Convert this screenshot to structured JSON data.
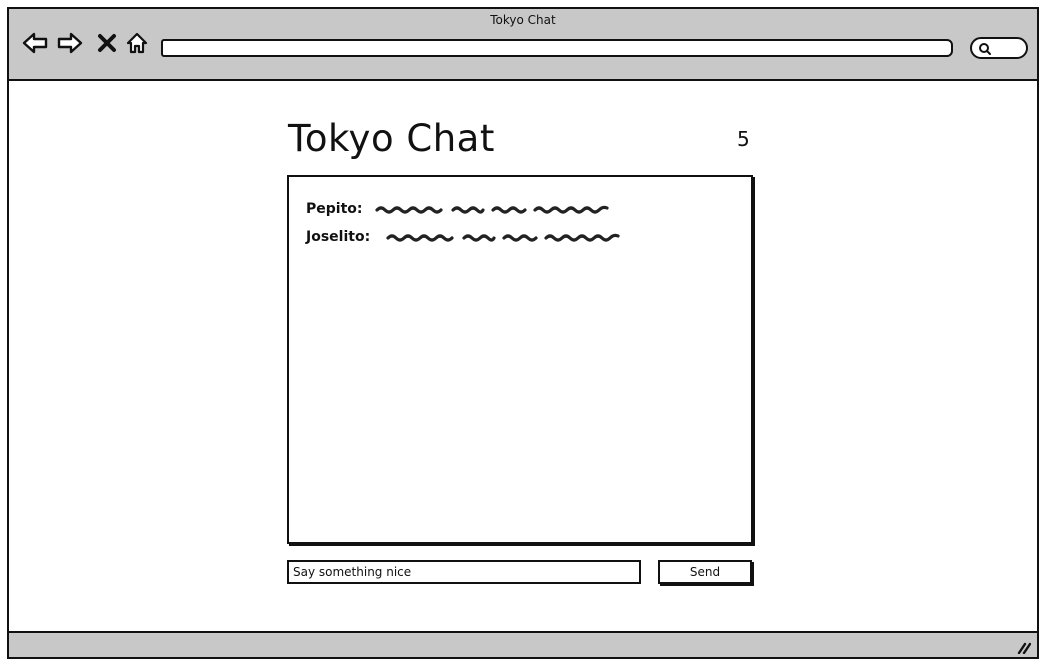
{
  "window": {
    "title": "Tokyo Chat"
  },
  "toolbar": {
    "back_icon": "arrow-left-icon",
    "forward_icon": "arrow-right-icon",
    "stop_icon": "close-icon",
    "home_icon": "home-icon",
    "search_icon": "search-icon",
    "address_value": ""
  },
  "page": {
    "title": "Tokyo Chat",
    "counter": "5"
  },
  "chat": {
    "messages": [
      {
        "user": "Pepito:",
        "text": ""
      },
      {
        "user": "Joselito:",
        "text": ""
      }
    ]
  },
  "composer": {
    "input_value": "Say something nice",
    "send_label": "Send"
  },
  "colors": {
    "chrome": "#c8c8c8",
    "ink": "#111111",
    "background": "#ffffff"
  }
}
